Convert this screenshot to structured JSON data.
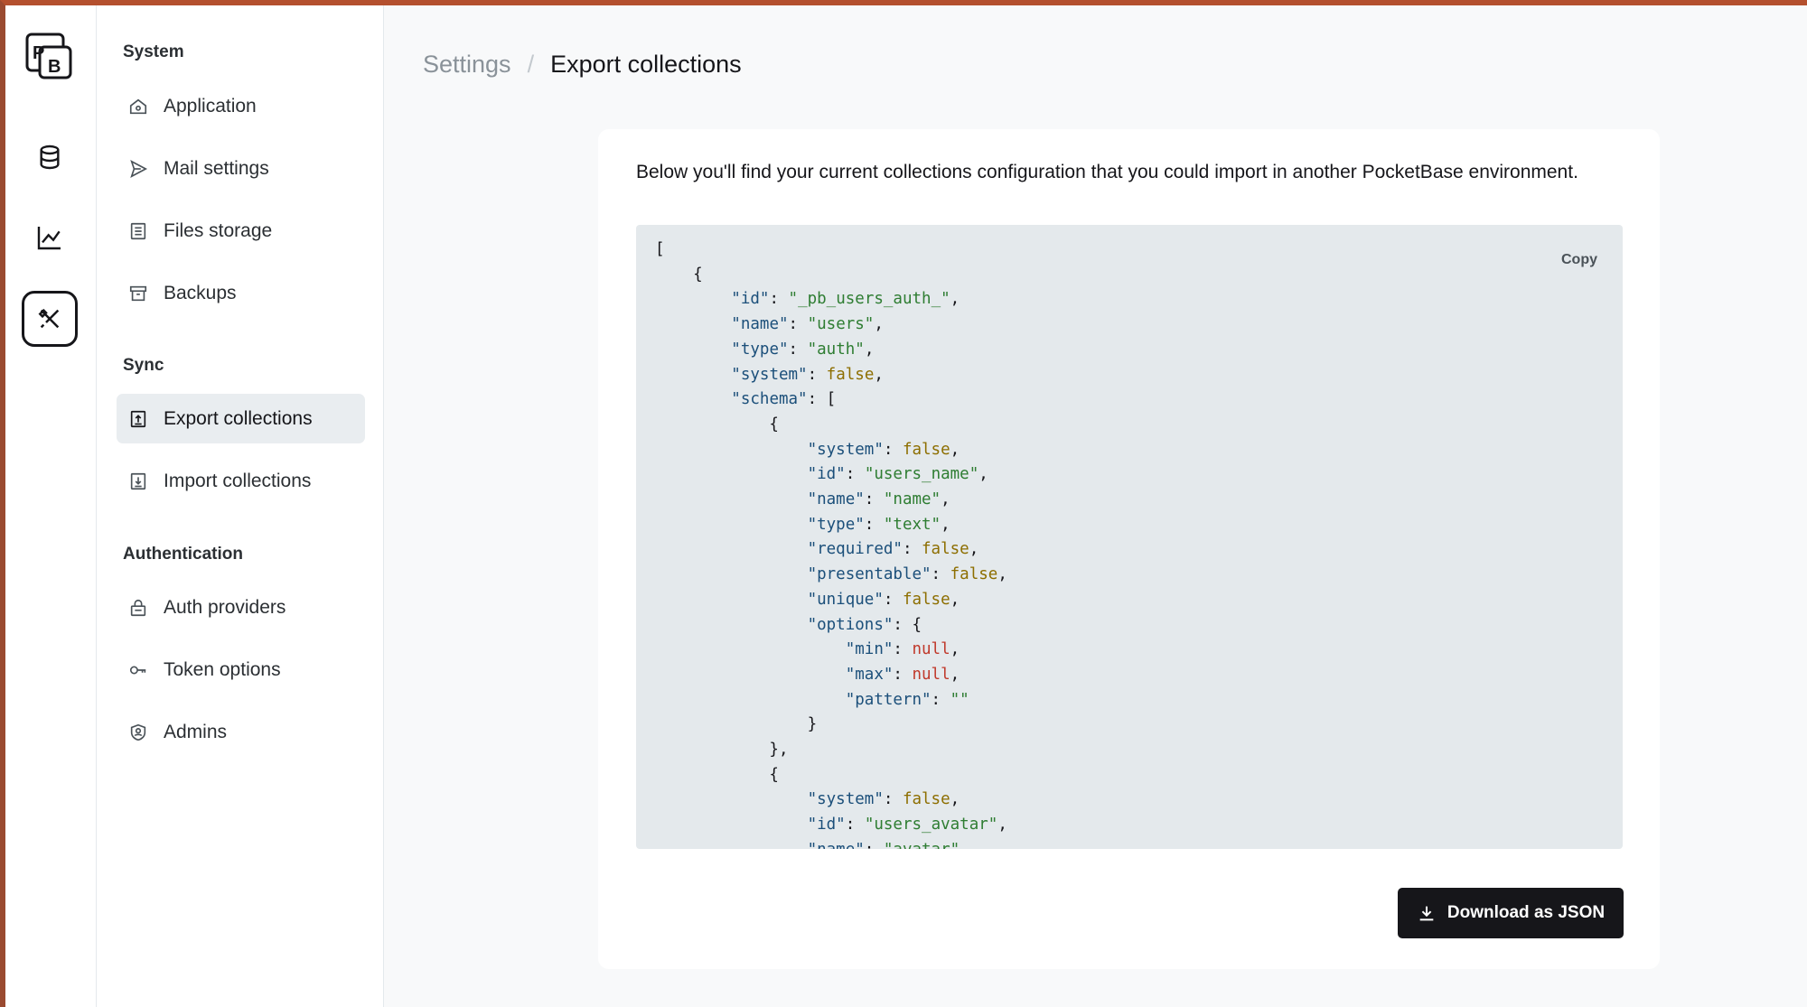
{
  "logo": {
    "letters": [
      "P",
      "B"
    ]
  },
  "rail": {
    "items": [
      {
        "icon": "database-icon",
        "active": false
      },
      {
        "icon": "chart-line-icon",
        "active": false
      },
      {
        "icon": "tools-icon",
        "active": true
      }
    ]
  },
  "sidebar": {
    "sections": [
      {
        "title": "System",
        "items": [
          {
            "label": "Application",
            "icon": "home-gear-icon"
          },
          {
            "label": "Mail settings",
            "icon": "send-icon"
          },
          {
            "label": "Files storage",
            "icon": "file-list-icon"
          },
          {
            "label": "Backups",
            "icon": "archive-icon"
          }
        ]
      },
      {
        "title": "Sync",
        "items": [
          {
            "label": "Export collections",
            "icon": "upload-icon",
            "active": true
          },
          {
            "label": "Import collections",
            "icon": "download-icon"
          }
        ]
      },
      {
        "title": "Authentication",
        "items": [
          {
            "label": "Auth providers",
            "icon": "lock-icon"
          },
          {
            "label": "Token options",
            "icon": "key-icon"
          },
          {
            "label": "Admins",
            "icon": "shield-user-icon"
          }
        ]
      }
    ]
  },
  "breadcrumb": {
    "parent": "Settings",
    "separator": "/",
    "current": "Export collections"
  },
  "main": {
    "intro": "Below you'll find your current collections configuration that you could import in another PocketBase environment.",
    "copy_label": "Copy",
    "download_label": "Download as JSON",
    "code_lines": [
      "[",
      "    {",
      "        \"id\": \"_pb_users_auth_\",",
      "        \"name\": \"users\",",
      "        \"type\": \"auth\",",
      "        \"system\": false,",
      "        \"schema\": [",
      "            {",
      "                \"system\": false,",
      "                \"id\": \"users_name\",",
      "                \"name\": \"name\",",
      "                \"type\": \"text\",",
      "                \"required\": false,",
      "                \"presentable\": false,",
      "                \"unique\": false,",
      "                \"options\": {",
      "                    \"min\": null,",
      "                    \"max\": null,",
      "                    \"pattern\": \"\"",
      "                }",
      "            },",
      "            {",
      "                \"system\": false,",
      "                \"id\": \"users_avatar\",",
      "                \"name\": \"avatar\","
    ]
  },
  "colors": {
    "accent": "#16161a",
    "window_border": "#b4502e",
    "json_key": "#1b4f7a",
    "json_string": "#2e7d32",
    "json_boolean": "#8d6e00",
    "json_null": "#c0392b"
  }
}
